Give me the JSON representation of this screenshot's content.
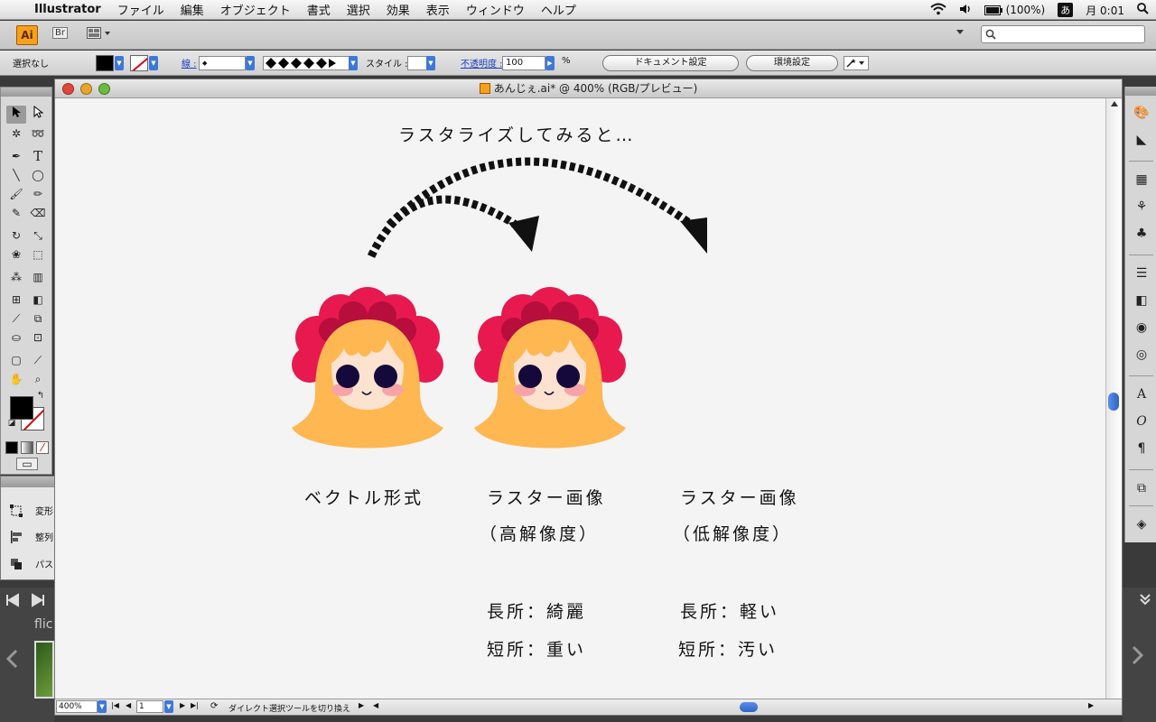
{
  "menubar": {
    "app": "Illustrator",
    "items": [
      "ファイル",
      "編集",
      "オブジェクト",
      "書式",
      "選択",
      "効果",
      "表示",
      "ウィンドウ",
      "ヘルプ"
    ],
    "battery": "(100%)",
    "ime": "あ",
    "clock": "月 0:01"
  },
  "appbar": {
    "logo": "Ai",
    "bridge": "Br"
  },
  "control": {
    "selection": "選択なし",
    "stroke_label": "線 :",
    "style_label": "スタイル :",
    "opacity_label": "不透明度 :",
    "opacity_value": "100",
    "percent": "%",
    "doc_settings": "ドキュメント設定",
    "prefs": "環境設定"
  },
  "document": {
    "title": "あんじぇ.ai* @ 400% (RGB/プレビュー)",
    "zoom": "400%",
    "page": "1",
    "status": "ダイレクト選択ツールを切り換え"
  },
  "artwork": {
    "headline": "ラスタライズしてみると…",
    "label_vector": "ベクトル形式",
    "label_raster1": "ラスター画像",
    "label_raster1_sub": "（高解像度）",
    "label_raster2": "ラスター画像",
    "label_raster2_sub": "（低解像度）",
    "pro1": "長所：綺麗",
    "con1": "短所：重い",
    "pro2": "長所：軽い",
    "con2": "短所：汚い"
  },
  "panel": {
    "items": [
      "変形",
      "整列",
      "パスファインダ"
    ]
  },
  "desktop": {
    "flic": "flic"
  },
  "colors": {
    "hair": "#ffb752",
    "flower": "#e8194f",
    "flower_dark": "#b70e3d",
    "face": "#fde2cf",
    "eyes": "#14093a",
    "cheek": "#f7a3a8"
  }
}
